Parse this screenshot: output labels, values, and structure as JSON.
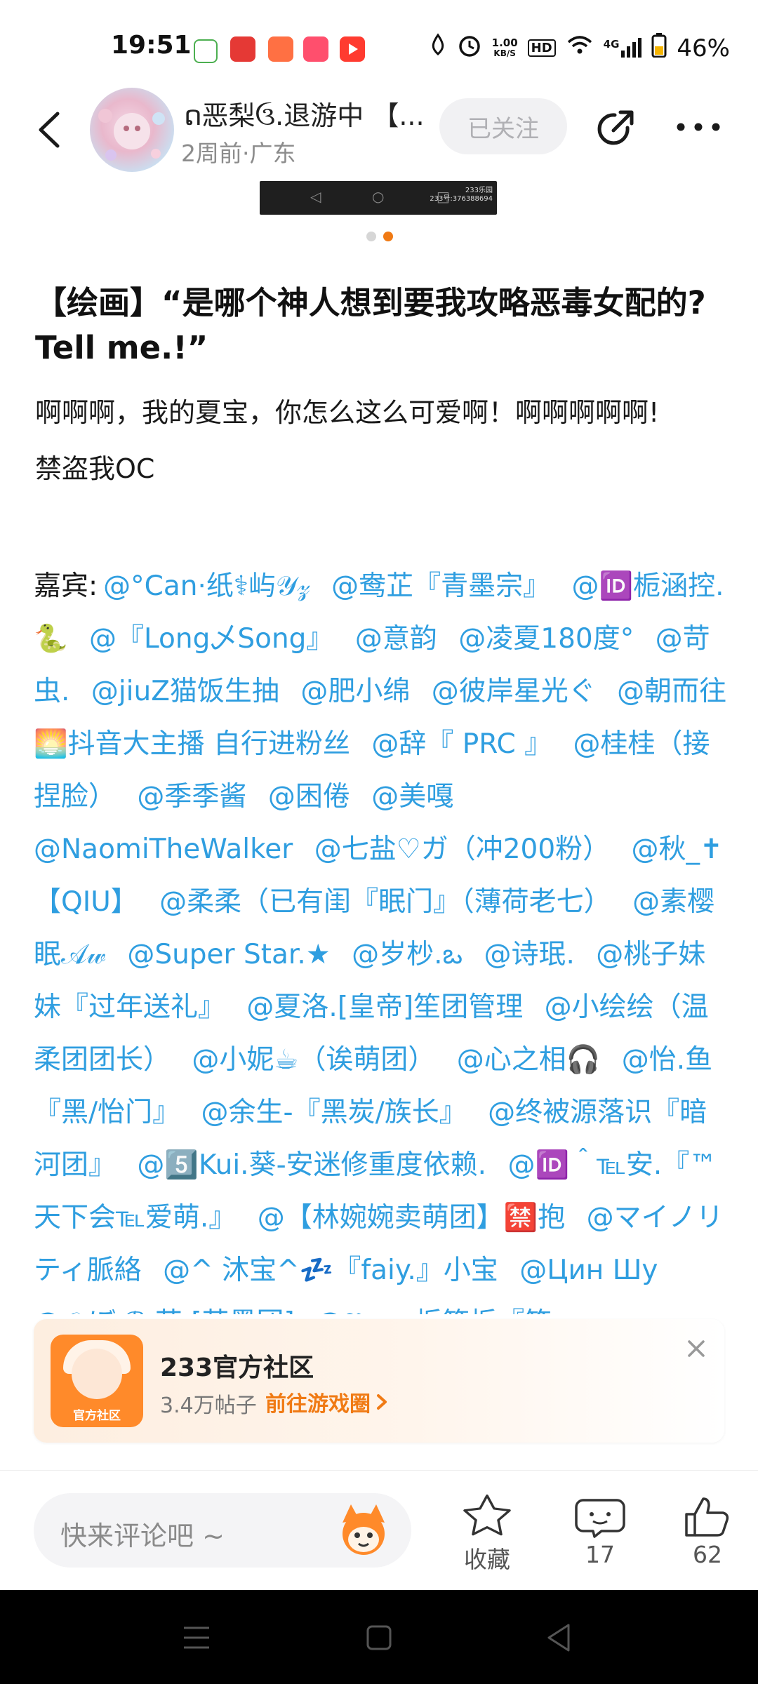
{
  "status_bar": {
    "time": "19:51",
    "net_speed_value": "1.00",
    "net_speed_unit": "KB/S",
    "hd": "HD",
    "signal": "4G",
    "battery": "46%"
  },
  "header": {
    "username": "ດ恶梨ઉ.退游中 【...",
    "meta": "2周前·广东",
    "follow_label": "已关注"
  },
  "image_watermark": [
    "233乐园",
    "233号:376388694"
  ],
  "post": {
    "title": "【绘画】“是哪个神人想到要我攻略恶毒女配的? Tell me.!”",
    "body_line1": "啊啊啊，我的夏宝，你怎么这么可爱啊！啊啊啊啊啊!",
    "body_line2": "禁盗我OC",
    "guests_label": "嘉宾:",
    "mentions": [
      "@°Can·纸⚕屿𝒴𝓏",
      "@鸯芷『青墨宗』",
      "@🆔栀涵控.🐍",
      "@『Long乄Song』",
      "@意韵",
      "@凌夏180度°",
      "@苛虫.",
      "@jiuZ猫饭生抽",
      "@肥小绵",
      "@彼岸星光ぐ",
      "@朝而往🌅抖音大主播 自行进粉丝",
      "@辞『 PRC 』",
      "@桂桂（接捏脸）",
      "@季季酱",
      "@困倦",
      "@美嘎",
      "@NaomiTheWalker",
      "@七盐♡ガ（冲200粉）",
      "@秋_✝【QIU】",
      "@柔柔（已有闺『眠门』（薄荷老七）",
      "@素樱眠𝒜𝓌",
      "@Super Star.★",
      "@岁杪.ఒ",
      "@诗珉.",
      "@桃子妹妹『过年送礼』",
      "@夏洛.[皇帝]笙团管理",
      "@小绘绘（温柔团团长）",
      "@小妮☕（诶萌团）",
      "@心之相🎧",
      "@怡.鱼『黑/怡门』",
      "@余生-『黑炭/族长』",
      "@终被源落识『暗河团』",
      "@5️⃣Kui.葵-安迷修重度依赖.",
      "@🆔＾℡安.『™天下会℡爱萌.』",
      "@【林婉婉卖萌团】🈲抱",
      "@マイノリティ脈絡",
      "@^ 沐宝^💤『faiy.』小宝",
      "@Цин Шу",
      "@𝒪𝓈ぼ ℛ 茧 [苦墨团]",
      "@𝕽𝖔𝖘 · 栀筱栀『笙"
    ]
  },
  "community_card": {
    "icon_label": "官方社区",
    "title": "233官方社区",
    "posts": "3.4万帖子",
    "link": "前往游戏圈"
  },
  "bottom_bar": {
    "comment_placeholder": "快来评论吧 ~",
    "collect_label": "收藏",
    "comments_count": "17",
    "likes_count": "62"
  },
  "colors": {
    "mention": "#2f9ee0",
    "accent_orange": "#f07a14",
    "follow_bg": "#f1f1f3"
  }
}
